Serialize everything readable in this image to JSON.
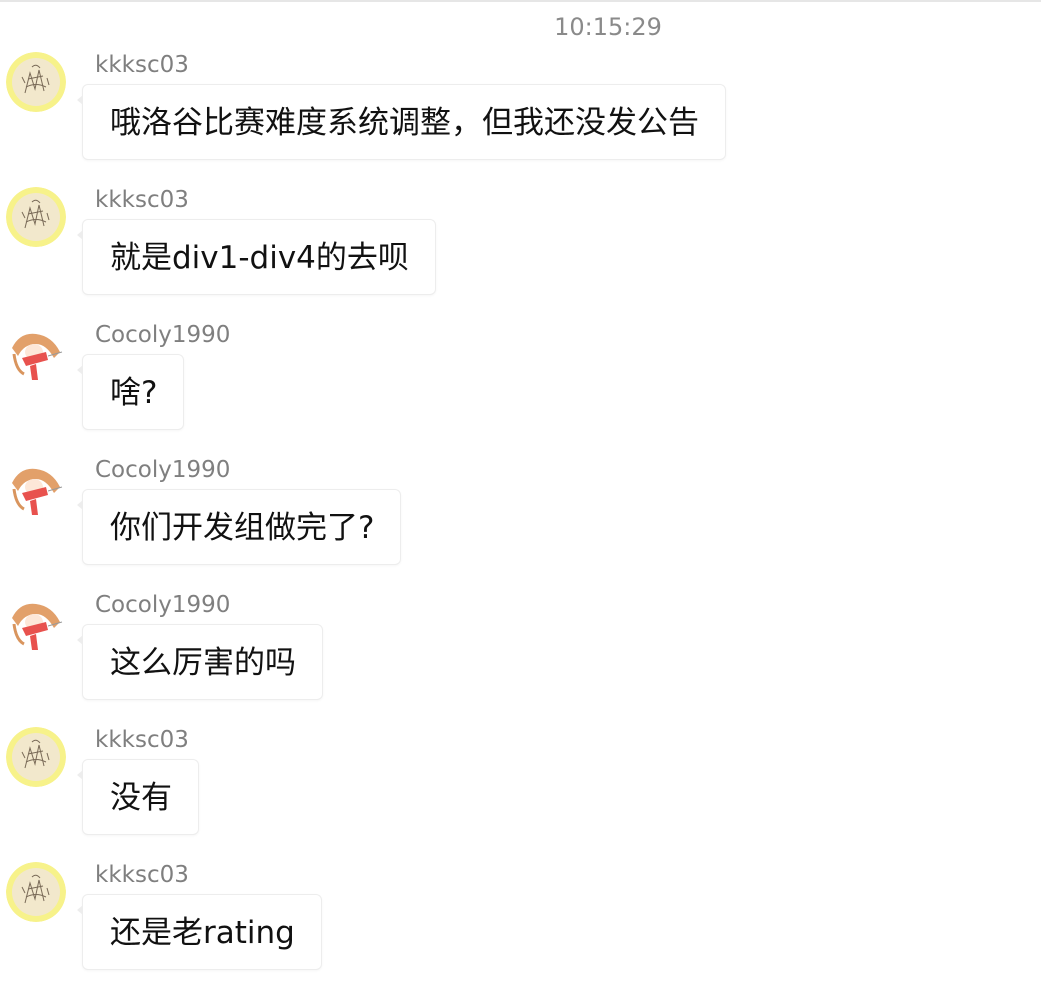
{
  "timestamp": "10:15:29",
  "colors": {
    "timestamp_text": "#8a8a8a",
    "sender_text": "#7f7f7f",
    "bubble_border": "#ededed",
    "message_text": "#111111",
    "avatar_kkksc03_ring": "#f7f28a",
    "avatar_cocoly_accent": "#e8524e"
  },
  "messages": [
    {
      "sender": "kkksc03",
      "avatar": "kkksc03-avatar-sketch",
      "text": "哦洛谷比赛难度系统调整，但我还没发公告"
    },
    {
      "sender": "kkksc03",
      "avatar": "kkksc03-avatar-sketch",
      "text": "就是div1-div4的去呗"
    },
    {
      "sender": "Cocoly1990",
      "avatar": "cocoly1990-avatar-anime",
      "text": "啥?"
    },
    {
      "sender": "Cocoly1990",
      "avatar": "cocoly1990-avatar-anime",
      "text": "你们开发组做完了?"
    },
    {
      "sender": "Cocoly1990",
      "avatar": "cocoly1990-avatar-anime",
      "text": "这么厉害的吗"
    },
    {
      "sender": "kkksc03",
      "avatar": "kkksc03-avatar-sketch",
      "text": "没有"
    },
    {
      "sender": "kkksc03",
      "avatar": "kkksc03-avatar-sketch",
      "text": "还是老rating"
    }
  ]
}
